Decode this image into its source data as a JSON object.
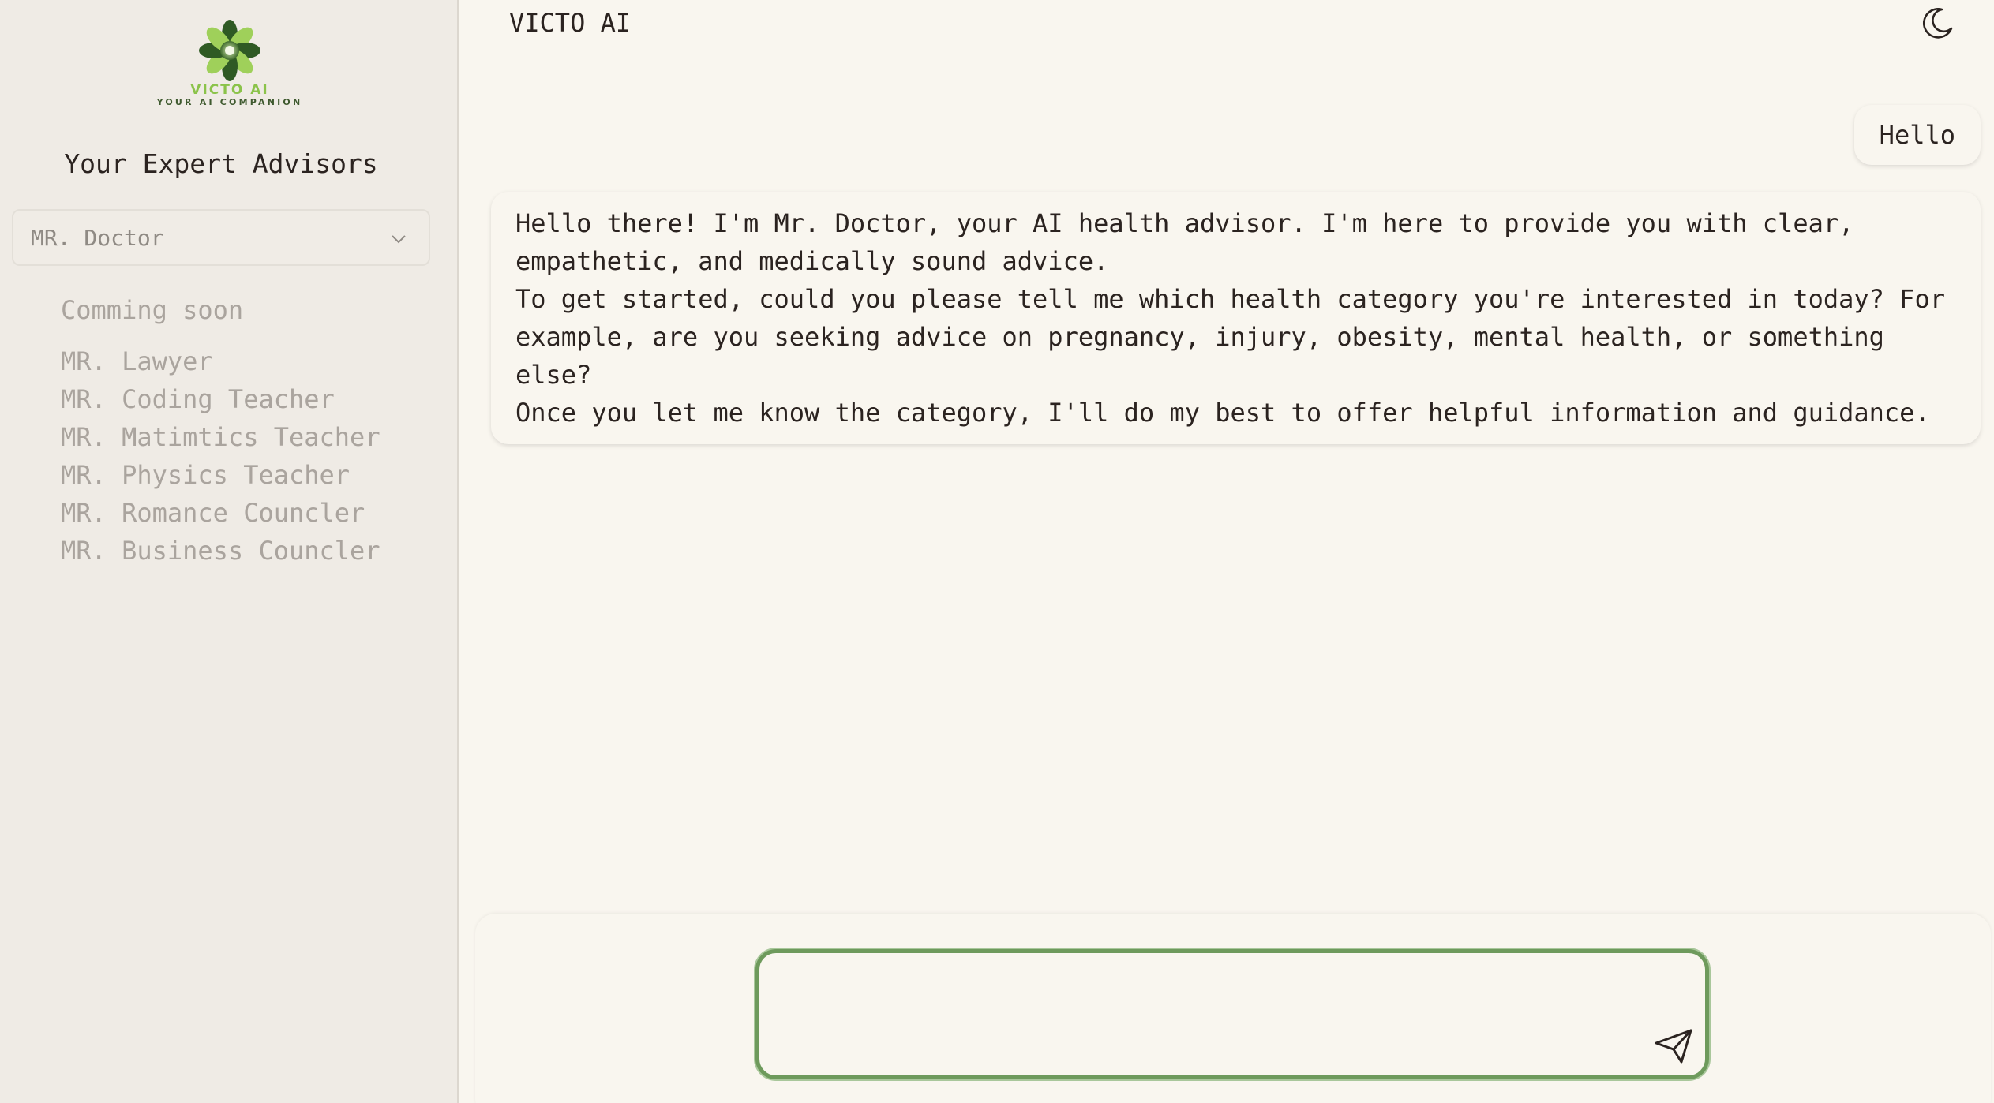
{
  "app": {
    "title": "VICTO AI"
  },
  "sidebar": {
    "logo_title": "VICTO AI",
    "logo_subtitle": "YOUR AI COMPANION",
    "heading": "Your Expert Advisors",
    "selected_advisor": "MR. Doctor",
    "coming_soon_label": "Comming soon",
    "coming_soon_items": [
      "MR. Lawyer",
      "MR. Coding Teacher",
      "MR. Matimtics Teacher",
      "MR. Physics Teacher",
      "MR. Romance Councler",
      "MR. Business Councler"
    ]
  },
  "chat": {
    "user_message": "Hello",
    "bot_message": [
      "Hello there! I'm Mr. Doctor, your AI health advisor. I'm here to provide you with clear, empathetic, and medically sound advice.",
      "To get started, could you please tell me which health category you're interested in today? For example, are you seeking advice on pregnancy, injury, obesity, mental health, or something else?",
      "Once you let me know the category, I'll do my best to offer helpful information and guidance."
    ]
  },
  "composer": {
    "value": ""
  },
  "icons": {
    "theme_toggle": "moon-icon",
    "send": "send-icon",
    "dropdown": "chevron-down-icon",
    "logo": "logo-icon"
  },
  "colors": {
    "sidebar_bg": "#efebe5",
    "main_bg": "#f9f6ef",
    "accent_green": "#6e9a5c",
    "logo_green": "#8bc34a"
  }
}
